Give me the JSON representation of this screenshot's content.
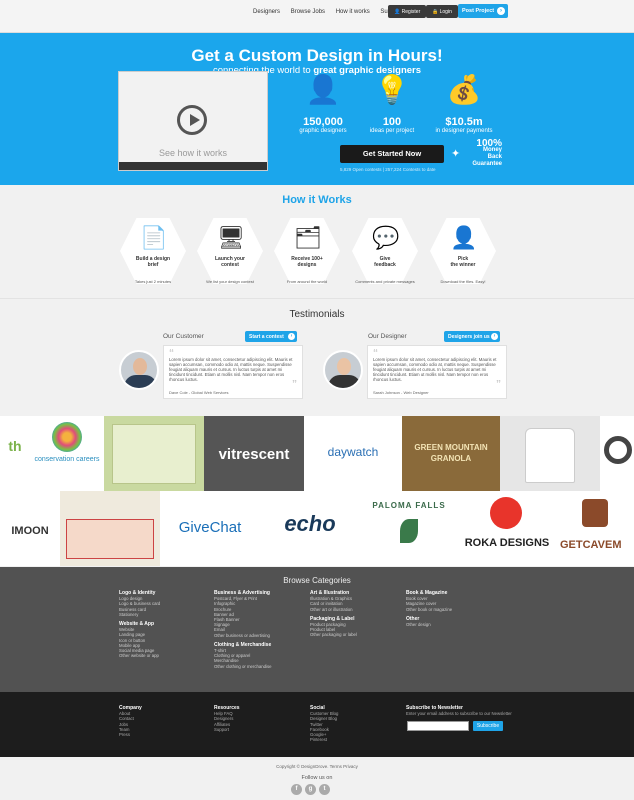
{
  "nav": {
    "links": [
      "Designers",
      "Browse Jobs",
      "How it works",
      "Support"
    ],
    "register": "Register",
    "login": "Login",
    "post": "Post Project"
  },
  "hero": {
    "title": "Get a Custom Design in Hours!",
    "subtitle_pre": "connecting the world to ",
    "subtitle_bold": "great graphic designers",
    "video_caption": "See how it works",
    "stats": [
      {
        "num": "150,000",
        "label": "graphic designers",
        "icon": "designer-icon"
      },
      {
        "num": "100",
        "label": "ideas per project",
        "icon": "lightbulb-icon"
      },
      {
        "num": "$10.5m",
        "label": "in designer payments",
        "icon": "money-icon"
      }
    ],
    "cta": "Get Started Now",
    "guarantee": {
      "pct": "100%",
      "line1": "Money Back",
      "line2": "Guarantee"
    },
    "contests": "5,829 Open contests  |  257,224 Contests to date"
  },
  "how": {
    "title": "How it Works",
    "steps": [
      {
        "label1": "Build a design",
        "label2": "brief",
        "sub": "Takes just 2 minutes",
        "icon": "brief-icon",
        "glyph": "📄"
      },
      {
        "label1": "Launch your",
        "label2": "contest",
        "sub": "We list your design contest",
        "icon": "launch-icon",
        "glyph": "🖥"
      },
      {
        "label1": "Receive 100+",
        "label2": "designs",
        "sub": "From around the world",
        "icon": "designs-icon",
        "glyph": "🗂"
      },
      {
        "label1": "Give",
        "label2": "feedback",
        "sub": "Comments and private messages",
        "icon": "feedback-icon",
        "glyph": "💬"
      },
      {
        "label1": "Pick",
        "label2": "the winner",
        "sub": "Download the files. Easy!",
        "icon": "winner-icon",
        "glyph": "👤"
      }
    ]
  },
  "testimonials": {
    "title": "Testimonials",
    "customer": {
      "heading": "Our Customer",
      "btn": "Start a contest",
      "text": "Lorem ipsum dolor sit amet, consectetur adipiscing elit. Mauris et sapien accumsan, commodo odio at, mattis neque. Suspendisse feugiat aliquam mauris et cursus. In luctus turpis at amet mi tincidunt tincidunt. Etiam ut mollis nisl. Nam tempor non eros rhoncus luctus.",
      "author": "Dave Cole - Global Web Services"
    },
    "designer": {
      "heading": "Our Designer",
      "btn": "Designers join us",
      "text": "Lorem ipsum dolor sit amet, consectetur adipiscing elit. Mauris et sapien accumsan, commodo odio at, mattis neque. Suspendisse feugiat aliquam mauris et cursus. In luctus turpis at amet mi tincidunt tincidunt. Etiam ut mollis nisl. Nam tempor non eros rhoncus luctus.",
      "author": "Sarah Johnson - Web Designer"
    }
  },
  "gallery": {
    "row1": [
      "th",
      "conservation careers",
      "",
      "vitrescent",
      "daywatch",
      "GREEN MOUNTAIN GRANOLA",
      "",
      ""
    ],
    "row2": [
      "IMOON",
      "",
      "GiveChat",
      "echo",
      "PALOMA FALLS",
      "ROKA DESIGNS",
      "GETCAVEM"
    ]
  },
  "browse": {
    "title": "Browse Categories",
    "cols": [
      [
        {
          "h": "Logo & Identity",
          "items": [
            "Logo design",
            "Logo & business card",
            "Business card",
            "Stationery"
          ]
        },
        {
          "h": "Website & App",
          "items": [
            "Website",
            "Landing page",
            "Icon or button",
            "Mobile app",
            "Social media page",
            "Other website or app"
          ]
        }
      ],
      [
        {
          "h": "Business & Advertising",
          "items": [
            "Postcard, Flyer & Print",
            "Infographic",
            "Brochure",
            "Banner ad",
            "Flash Banner",
            "Signage",
            "Email",
            "Other business or advertising"
          ]
        },
        {
          "h": "Clothing & Merchandise",
          "items": [
            "T-shirt",
            "Clothing or apparel",
            "Merchandise",
            "Other clothing or merchandise"
          ]
        }
      ],
      [
        {
          "h": "Art & Illustration",
          "items": [
            "Illustration & Graphics",
            "Card or invitation",
            "Other art or illustration"
          ]
        },
        {
          "h": "Packaging & Label",
          "items": [
            "Product packaging",
            "Product label",
            "Other packaging or label"
          ]
        }
      ],
      [
        {
          "h": "Book & Magazine",
          "items": [
            "Book cover",
            "Magazine cover",
            "Other book or magazine"
          ]
        },
        {
          "h": "Other",
          "items": [
            "Other design"
          ]
        }
      ]
    ]
  },
  "footer": {
    "company": {
      "h": "Company",
      "items": [
        "About",
        "Contact",
        "Jobs",
        "Team",
        "Press"
      ]
    },
    "resources": {
      "h": "Resources",
      "items": [
        "Help FAQ",
        "Designers",
        "Affiliates",
        "Support"
      ]
    },
    "social": {
      "h": "Social",
      "items": [
        "Customer Blog",
        "Designer Blog",
        "Twitter",
        "Facebook",
        "Google+",
        "Pinterest"
      ]
    },
    "newsletter": {
      "h": "Subscribe to Newsletter",
      "text": "Enter your email address to subscribe to our Newsletter",
      "btn": "Subscribe"
    },
    "copyright": "Copyright © DesignDrove.  Terms  Privacy",
    "follow": "Follow us on"
  }
}
